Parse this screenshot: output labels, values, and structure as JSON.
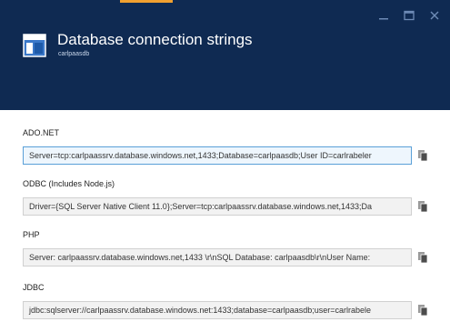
{
  "header": {
    "title": "Database connection strings",
    "subtitle": "carlpaasdb",
    "accent_color": "#f0a030",
    "background_color": "#0f2a52",
    "icon": "database-grid-icon"
  },
  "window_controls": [
    {
      "name": "minimize",
      "icon": "minimize-icon"
    },
    {
      "name": "maximize",
      "icon": "maximize-icon"
    },
    {
      "name": "close",
      "icon": "close-icon"
    }
  ],
  "connection_strings": [
    {
      "label": "ADO.NET",
      "value": "Server=tcp:carlpaassrv.database.windows.net,1433;Database=carlpaasdb;User ID=carlrabeler",
      "copy_icon": "copy-icon",
      "focused": true
    },
    {
      "label": "ODBC (Includes Node.js)",
      "value": "Driver={SQL Server Native Client 11.0};Server=tcp:carlpaassrv.database.windows.net,1433;Da",
      "copy_icon": "copy-icon",
      "focused": false
    },
    {
      "label": "PHP",
      "value": "Server: carlpaassrv.database.windows.net,1433 \\r\\nSQL Database: carlpaasdb\\r\\nUser Name:",
      "copy_icon": "copy-icon",
      "focused": false
    },
    {
      "label": "JDBC",
      "value": "jdbc:sqlserver://carlpaassrv.database.windows.net:1433;database=carlpaasdb;user=carlrabele",
      "copy_icon": "copy-icon",
      "focused": false
    }
  ]
}
